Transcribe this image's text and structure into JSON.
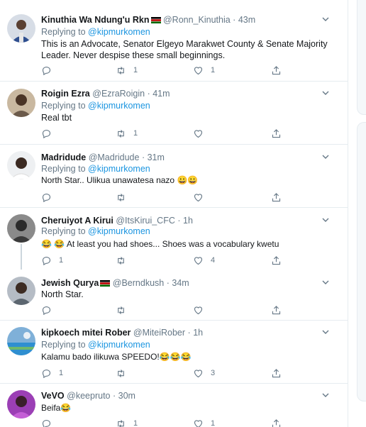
{
  "tweets": [
    {
      "name": "Kinuthia Wa Ndung'u Rkn",
      "handle": "@Ronn_Kinuthia",
      "time": "43m",
      "replying_prefix": "Replying to",
      "replying_to": "@kipmurkomen",
      "text": "This is an Advocate, Senator Elgeyo Marakwet County & Senate Majority Leader. Never despise these small beginnings.",
      "replies": "",
      "retweets": "1",
      "likes": "1"
    },
    {
      "name": "Roigin Ezra",
      "handle": "@EzraRoigin",
      "time": "41m",
      "replying_prefix": "Replying to",
      "replying_to": "@kipmurkomen",
      "text": "Real tbt",
      "replies": "",
      "retweets": "1",
      "likes": ""
    },
    {
      "name": "Madridude",
      "handle": "@Madridude",
      "time": "31m",
      "replying_prefix": "Replying to",
      "replying_to": "@kipmurkomen",
      "text": "North Star.. Ulikua unawatesa nazo 😀😀",
      "replies": "",
      "retweets": "",
      "likes": ""
    },
    {
      "name": "Cheruiyot A Kirui",
      "handle": "@ItsKirui_CFC",
      "time": "1h",
      "replying_prefix": "Replying to",
      "replying_to": "@kipmurkomen",
      "text": "😂 😂 At least you had shoes... Shoes was a vocabulary kwetu",
      "replies": "1",
      "retweets": "",
      "likes": "4"
    },
    {
      "name": "Jewish Qurya",
      "handle": "@Berndkush",
      "time": "34m",
      "replying_prefix": "",
      "replying_to": "",
      "text": "North Star.",
      "replies": "",
      "retweets": "",
      "likes": ""
    },
    {
      "name": "kipkoech mitei Rober",
      "handle": "@MiteiRober",
      "time": "1h",
      "replying_prefix": "Replying to",
      "replying_to": "@kipmurkomen",
      "text": "Kalamu bado ilikuwa SPEEDO!😂😂😂",
      "replies": "1",
      "retweets": "",
      "likes": "3"
    },
    {
      "name": "VeVO",
      "handle": "@keepruto",
      "time": "30m",
      "replying_prefix": "",
      "replying_to": "",
      "text": "Beifa😂",
      "replies": "",
      "retweets": "1",
      "likes": "1"
    }
  ],
  "separator": "·",
  "colors": {
    "link": "#1b95e0",
    "muted": "#657786",
    "border": "#e6ecf0",
    "icon": "#657786"
  },
  "icons": {
    "reply": "reply-icon",
    "retweet": "retweet-icon",
    "like": "heart-icon",
    "share": "share-icon",
    "more": "chevron-down-icon"
  }
}
